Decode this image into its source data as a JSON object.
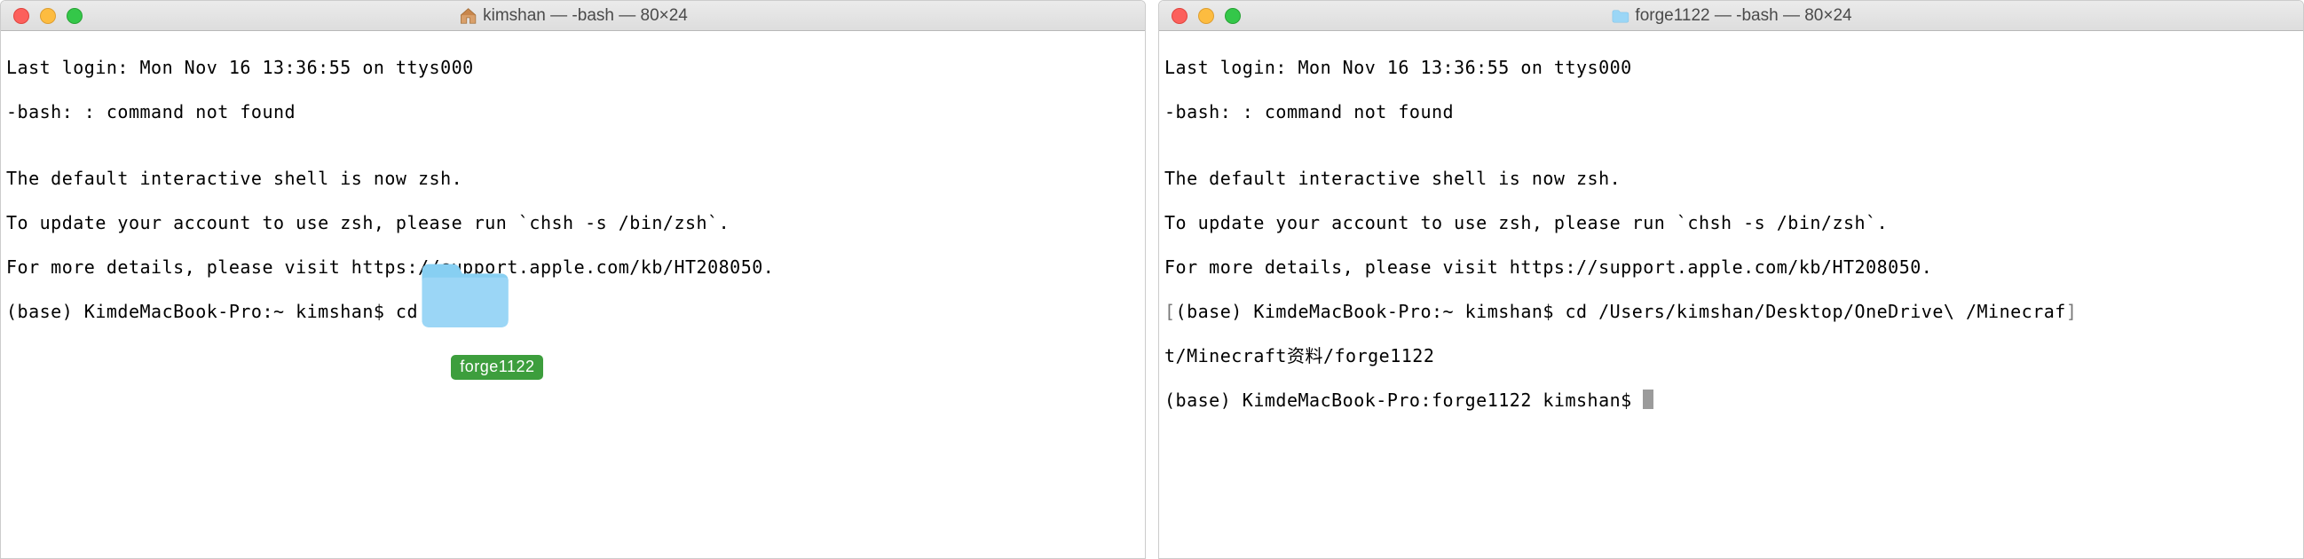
{
  "left": {
    "title": "kimshan — -bash — 80×24",
    "lines": {
      "l1": "Last login: Mon Nov 16 13:36:55 on ttys000",
      "l2": "-bash: : command not found",
      "l3": "",
      "l4": "The default interactive shell is now zsh.",
      "l5": "To update your account to use zsh, please run `chsh -s /bin/zsh`.",
      "l6": "For more details, please visit https://support.apple.com/kb/HT208050.",
      "l7": "(base) KimdeMacBook-Pro:~ kimshan$ cd "
    },
    "folder": {
      "label": "forge1122"
    }
  },
  "right": {
    "title": "forge1122 — -bash — 80×24",
    "lines": {
      "l1": "Last login: Mon Nov 16 13:36:55 on ttys000",
      "l2": "-bash: : command not found",
      "l3": "",
      "l4": "The default interactive shell is now zsh.",
      "l5": "To update your account to use zsh, please run `chsh -s /bin/zsh`.",
      "l6": "For more details, please visit https://support.apple.com/kb/HT208050.",
      "l7a_open": "[",
      "l7a": "(base) KimdeMacBook-Pro:~ kimshan$ cd /Users/kimshan/Desktop/OneDrive\\ /Minecraf",
      "l7a_close": "]",
      "l7b": "t/Minecraft资料/forge1122",
      "l8": "(base) KimdeMacBook-Pro:forge1122 kimshan$ "
    }
  }
}
